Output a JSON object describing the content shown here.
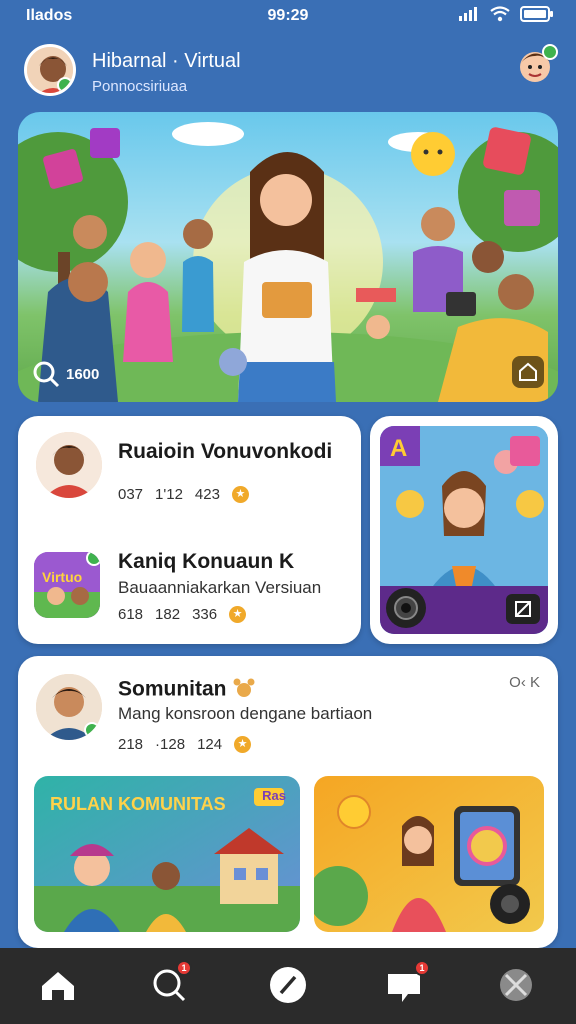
{
  "status_bar": {
    "carrier": "Ilados",
    "time": "99:29"
  },
  "header": {
    "title": "Hibarnal · Virtual",
    "subtitle": "Ponnocsiriuaa"
  },
  "hero": {
    "search_label": "1600"
  },
  "feed": [
    {
      "title": "Ruaioin Vonuvonkodi",
      "stat1": "037",
      "stat2": "1'12",
      "stat3": "423"
    },
    {
      "title": "Kaniq Konuaun K",
      "description": "Bauaanniakarkan Versiuan",
      "stat1": "618",
      "stat2": "182",
      "stat3": "336"
    }
  ],
  "community": {
    "title": "Somunitan",
    "description": "Mang konsroon dengane bartiaon",
    "more_label": "O‹ K",
    "stat1": "218",
    "stat2": "·128",
    "stat3": "124",
    "banner_text": "RULAN KOMUNITAS",
    "banner_tag": "Ras"
  },
  "nav": [
    {
      "icon": "home-icon"
    },
    {
      "icon": "search-icon",
      "badge": "1"
    },
    {
      "icon": "pen-icon"
    },
    {
      "icon": "chat-icon",
      "badge": "1"
    },
    {
      "icon": "globe-icon"
    }
  ]
}
